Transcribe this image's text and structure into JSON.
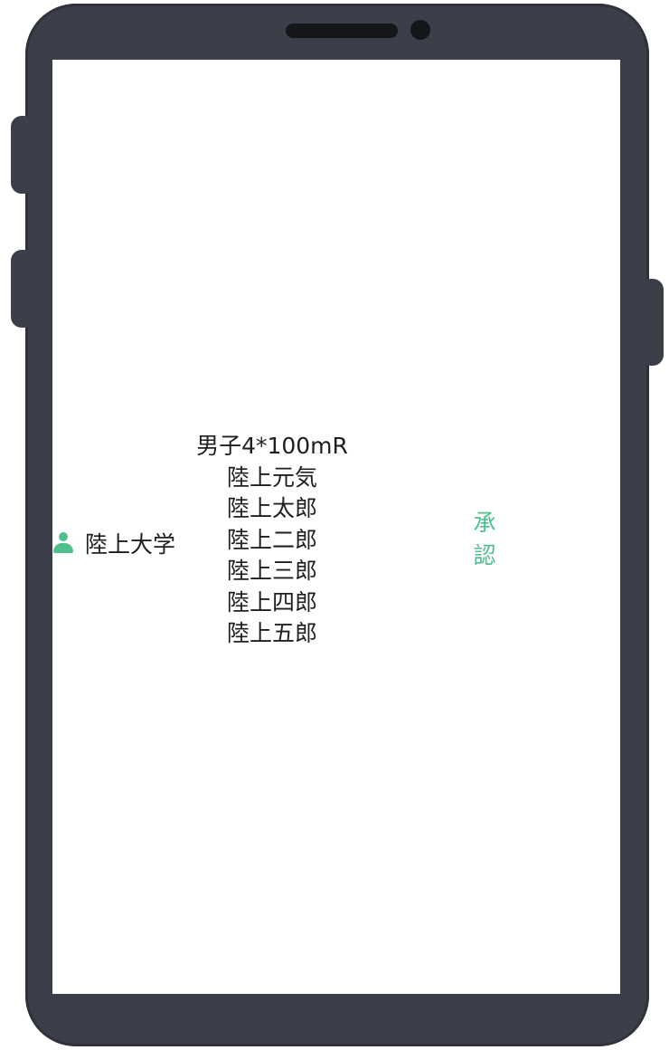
{
  "team": {
    "name": "陸上大学",
    "icon": "person-icon"
  },
  "entry": {
    "event": "男子4*100mR",
    "members": [
      "陸上元気",
      "陸上太郎",
      "陸上二郎",
      "陸上三郎",
      "陸上四郎",
      "陸上五郎"
    ]
  },
  "approve_button": {
    "chars": [
      "承",
      "認"
    ],
    "color": "#4fc08d"
  }
}
